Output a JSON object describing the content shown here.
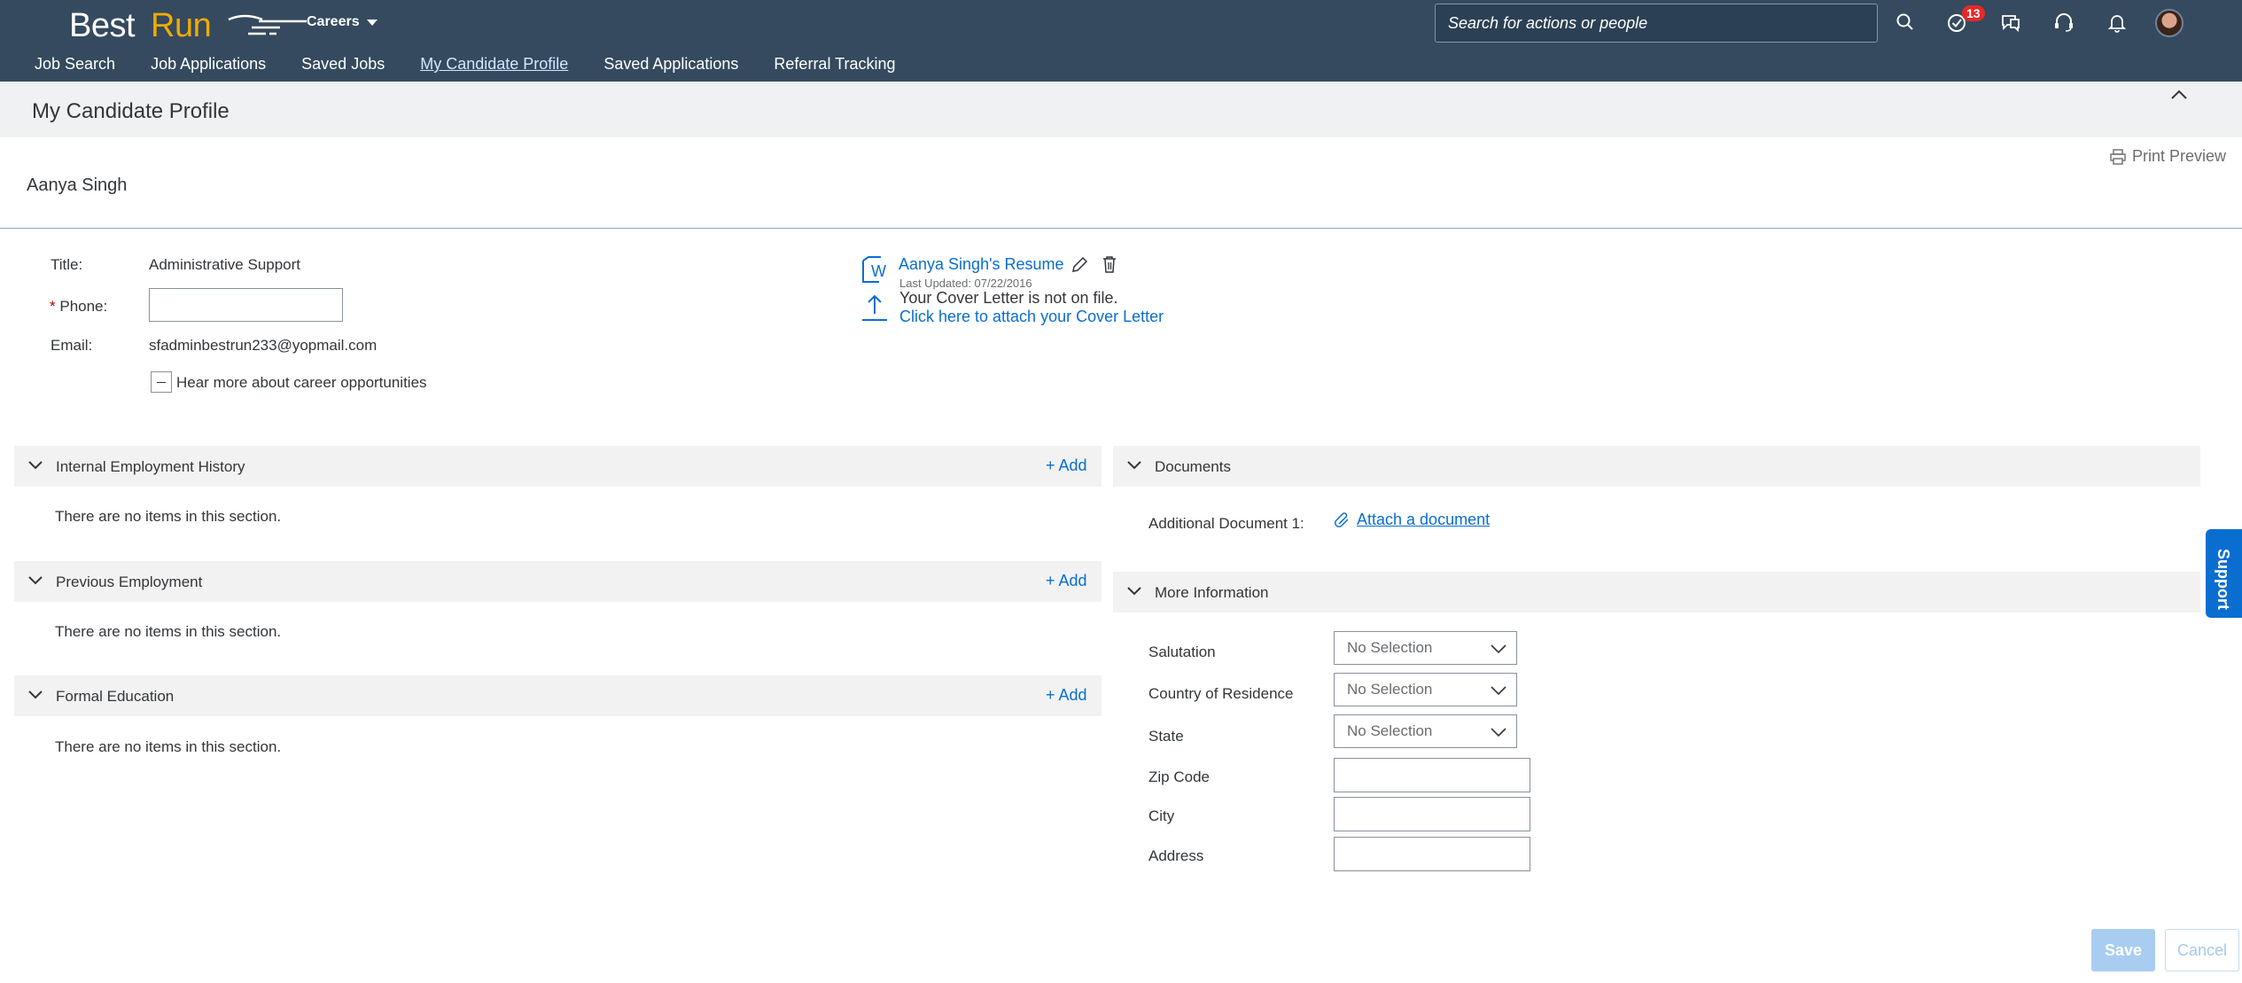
{
  "header": {
    "logo_best": "Best",
    "logo_run": "Run",
    "app_menu": "Careers",
    "search_placeholder": "Search for actions or people",
    "notification_count": "13",
    "nav": [
      "Job Search",
      "Job Applications",
      "Saved Jobs",
      "My Candidate Profile",
      "Saved Applications",
      "Referral Tracking"
    ],
    "active_nav": "My Candidate Profile"
  },
  "page": {
    "title": "My Candidate Profile",
    "print_preview": "Print Preview",
    "candidate_name": "Aanya Singh"
  },
  "basic": {
    "title_label": "Title:",
    "title_value": "Administrative Support",
    "phone_required": "*",
    "phone_label": "Phone:",
    "phone_value": "",
    "email_label": "Email:",
    "email_value": "sfadminbestrun233@yopmail.com",
    "career_opt_in": "Hear more about career opportunities"
  },
  "resume": {
    "link": "Aanya Singh's Resume",
    "last_updated": "Last Updated: 07/22/2016",
    "cover_status": "Your Cover Letter is not on file.",
    "cover_attach": "Click here to attach your Cover Letter"
  },
  "sections_left": [
    {
      "title": "Internal Employment History",
      "add": "+ Add",
      "empty": "There are no items in this section."
    },
    {
      "title": "Previous Employment",
      "add": "+ Add",
      "empty": "There are no items in this section."
    },
    {
      "title": "Formal Education",
      "add": "+ Add",
      "empty": "There are no items in this section."
    }
  ],
  "documents": {
    "title": "Documents",
    "additional_label": "Additional Document 1:",
    "attach": "Attach a document"
  },
  "more_info": {
    "title": "More Information",
    "salutation_label": "Salutation",
    "salutation_value": "No Selection",
    "country_label": "Country of Residence",
    "country_value": "No Selection",
    "state_label": "State",
    "state_value": "No Selection",
    "zip_label": "Zip Code",
    "city_label": "City",
    "address_label": "Address"
  },
  "support": "Support",
  "actions": {
    "save": "Save",
    "cancel": "Cancel"
  },
  "colors": {
    "shell": "#354a5f",
    "link": "#0a6ed1",
    "brand_accent": "#f0ab00",
    "badge": "#e52929"
  }
}
